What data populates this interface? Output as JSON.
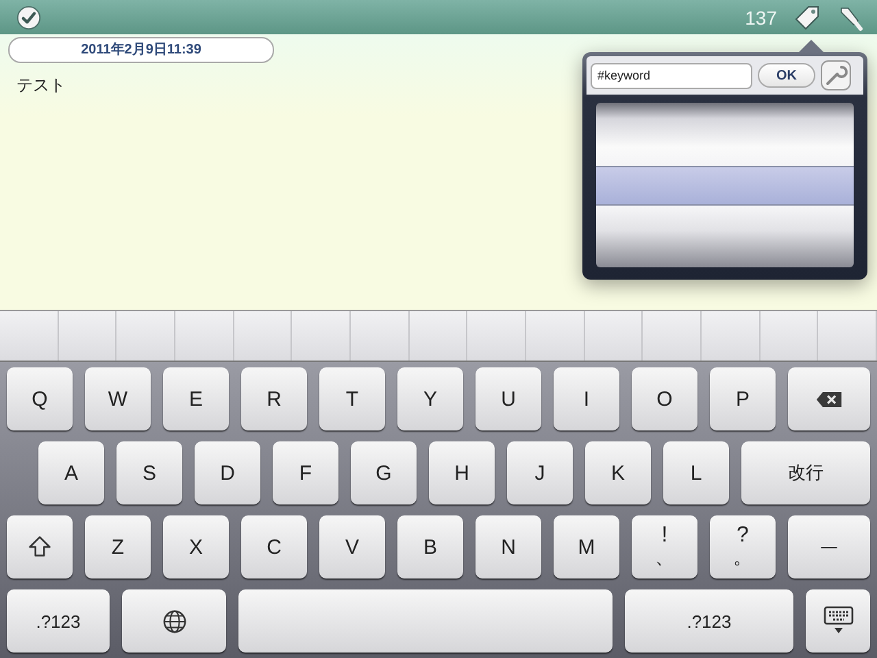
{
  "toolbar": {
    "count": "137"
  },
  "note": {
    "date": "2011年2月9日11:39",
    "text": "テスト"
  },
  "tag_popover": {
    "input": {
      "value": "#keyword"
    },
    "ok_button": "OK"
  },
  "keyboard": {
    "rows": [
      [
        {
          "kind": "letter",
          "label": "Q"
        },
        {
          "kind": "letter",
          "label": "W"
        },
        {
          "kind": "letter",
          "label": "E"
        },
        {
          "kind": "letter",
          "label": "R"
        },
        {
          "kind": "letter",
          "label": "T"
        },
        {
          "kind": "letter",
          "label": "Y"
        },
        {
          "kind": "letter",
          "label": "U"
        },
        {
          "kind": "letter",
          "label": "I"
        },
        {
          "kind": "letter",
          "label": "O"
        },
        {
          "kind": "letter",
          "label": "P"
        },
        {
          "kind": "backspace"
        }
      ],
      [
        {
          "kind": "letter",
          "label": "A"
        },
        {
          "kind": "letter",
          "label": "S"
        },
        {
          "kind": "letter",
          "label": "D"
        },
        {
          "kind": "letter",
          "label": "F"
        },
        {
          "kind": "letter",
          "label": "G"
        },
        {
          "kind": "letter",
          "label": "H"
        },
        {
          "kind": "letter",
          "label": "J"
        },
        {
          "kind": "letter",
          "label": "K"
        },
        {
          "kind": "letter",
          "label": "L"
        },
        {
          "kind": "wide",
          "label": "改行"
        }
      ],
      [
        {
          "kind": "shift"
        },
        {
          "kind": "letter",
          "label": "Z"
        },
        {
          "kind": "letter",
          "label": "X"
        },
        {
          "kind": "letter",
          "label": "C"
        },
        {
          "kind": "letter",
          "label": "V"
        },
        {
          "kind": "letter",
          "label": "B"
        },
        {
          "kind": "letter",
          "label": "N"
        },
        {
          "kind": "letter",
          "label": "M"
        },
        {
          "kind": "dual",
          "label": "!",
          "sub": "、"
        },
        {
          "kind": "dual",
          "label": "?",
          "sub": "。"
        },
        {
          "kind": "wide",
          "label": "—"
        }
      ],
      [
        {
          "kind": "mode",
          "label": ".?123"
        },
        {
          "kind": "globe"
        },
        {
          "kind": "space"
        },
        {
          "kind": "mode",
          "label": ".?123"
        },
        {
          "kind": "hide"
        }
      ]
    ]
  }
}
